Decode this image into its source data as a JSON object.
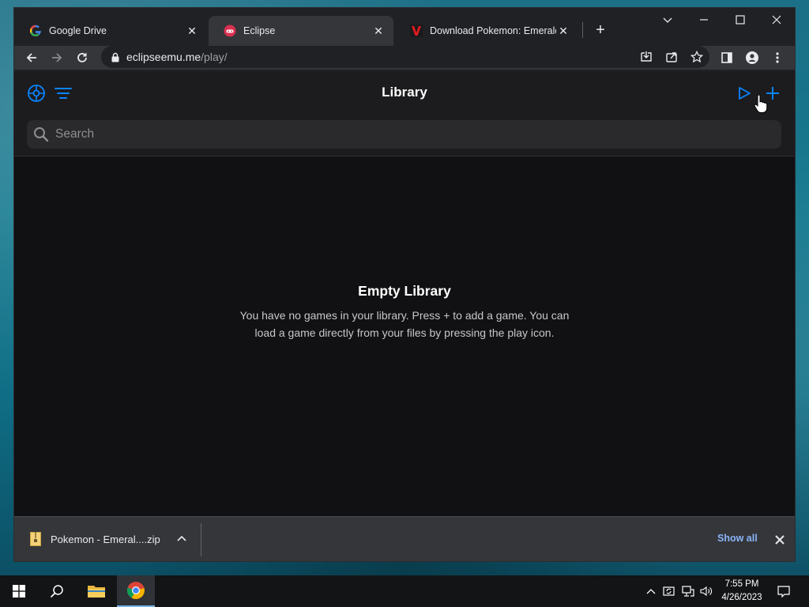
{
  "browser": {
    "tabs": [
      {
        "title": "Google Drive",
        "icon": "google-icon"
      },
      {
        "title": "Eclipse",
        "icon": "eclipse-icon"
      },
      {
        "title": "Download Pokemon: Emerald Ve",
        "icon": "vimm-icon"
      }
    ],
    "url_host": "eclipseemu.me",
    "url_path": "/play/"
  },
  "page": {
    "title": "Library",
    "search_placeholder": "Search",
    "empty_title": "Empty Library",
    "empty_text": "You have no games in your library. Press + to add a game. You can load a game directly from your files by pressing the play icon.",
    "accent_color": "#0a84ff"
  },
  "downloads": {
    "file_name": "Pokemon - Emeral....zip",
    "show_all": "Show all"
  },
  "taskbar": {
    "time": "7:55 PM",
    "date": "4/26/2023"
  }
}
